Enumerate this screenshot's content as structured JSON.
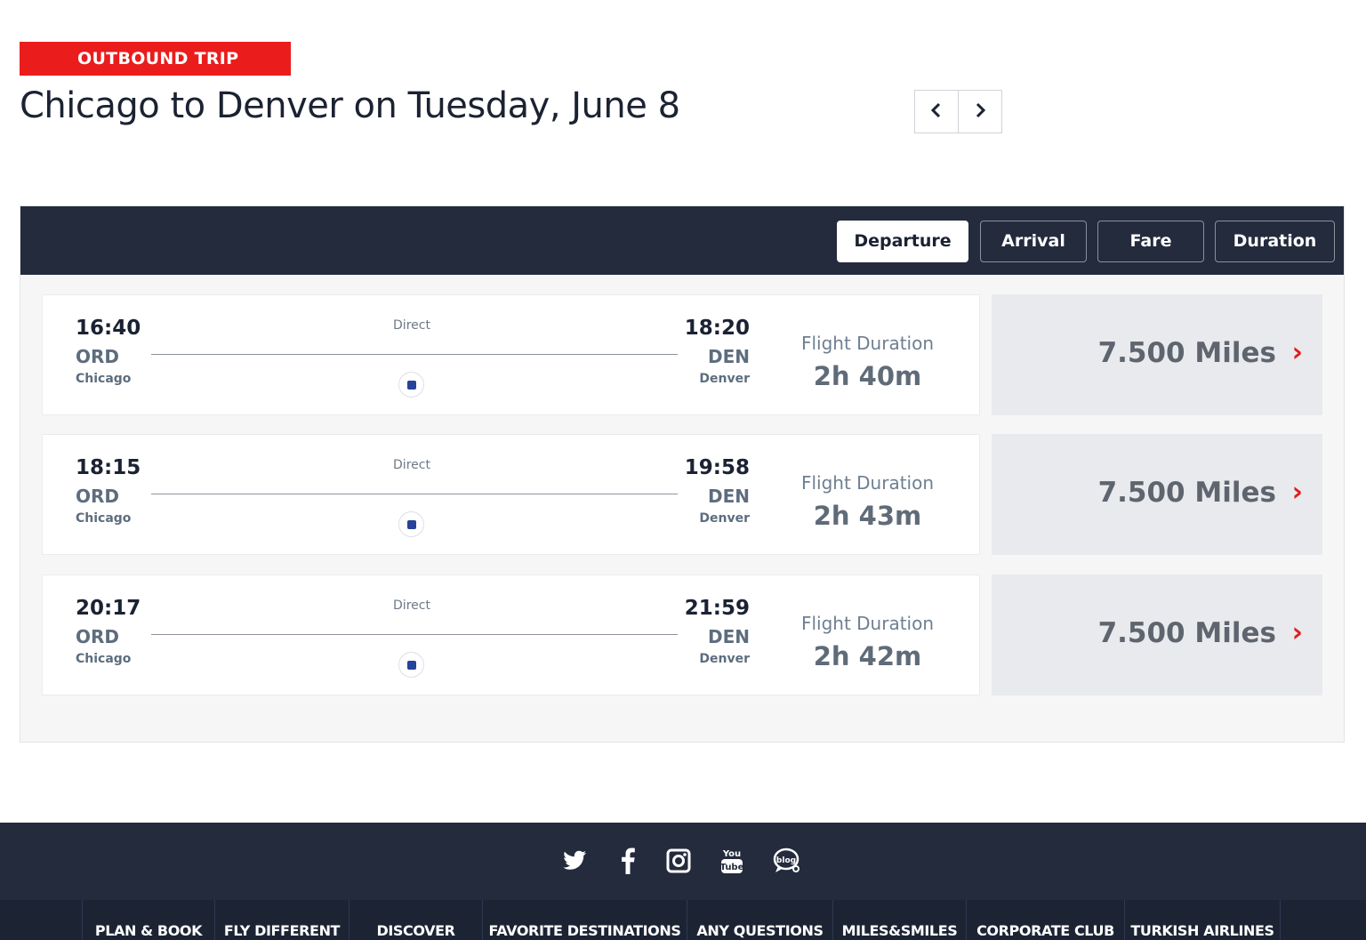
{
  "trip_badge": "OUTBOUND TRIP",
  "route_title": "Chicago to Denver on Tuesday, June 8",
  "pager": {
    "prev": "‹",
    "next": "›"
  },
  "sort_options": [
    "Departure",
    "Arrival",
    "Fare",
    "Duration"
  ],
  "sort_active": "Departure",
  "flights": [
    {
      "dep_time": "16:40",
      "dep_code": "ORD",
      "dep_city": "Chicago",
      "stops": "Direct",
      "arr_time": "18:20",
      "arr_code": "DEN",
      "arr_city": "Denver",
      "duration_label": "Flight Duration",
      "duration": "2h 40m",
      "fare": "7.500 Miles"
    },
    {
      "dep_time": "18:15",
      "dep_code": "ORD",
      "dep_city": "Chicago",
      "stops": "Direct",
      "arr_time": "19:58",
      "arr_code": "DEN",
      "arr_city": "Denver",
      "duration_label": "Flight Duration",
      "duration": "2h 43m",
      "fare": "7.500 Miles"
    },
    {
      "dep_time": "20:17",
      "dep_code": "ORD",
      "dep_city": "Chicago",
      "stops": "Direct",
      "arr_time": "21:59",
      "arr_code": "DEN",
      "arr_city": "Denver",
      "duration_label": "Flight Duration",
      "duration": "2h 42m",
      "fare": "7.500 Miles"
    }
  ],
  "fare_arrow": "›",
  "social_icons": [
    "twitter-icon",
    "facebook-icon",
    "instagram-icon",
    "youtube-icon",
    "blog-icon"
  ],
  "footer_nav": [
    "PLAN & BOOK",
    "FLY DIFFERENT",
    "DISCOVER",
    "FAVORITE DESTINATIONS",
    "ANY QUESTIONS",
    "MILES&SMILES",
    "CORPORATE CLUB",
    "TURKISH AIRLINES"
  ],
  "colors": {
    "brand_red": "#ea1c1c",
    "navy": "#232b3d",
    "fare_bg": "#e9eaed"
  }
}
